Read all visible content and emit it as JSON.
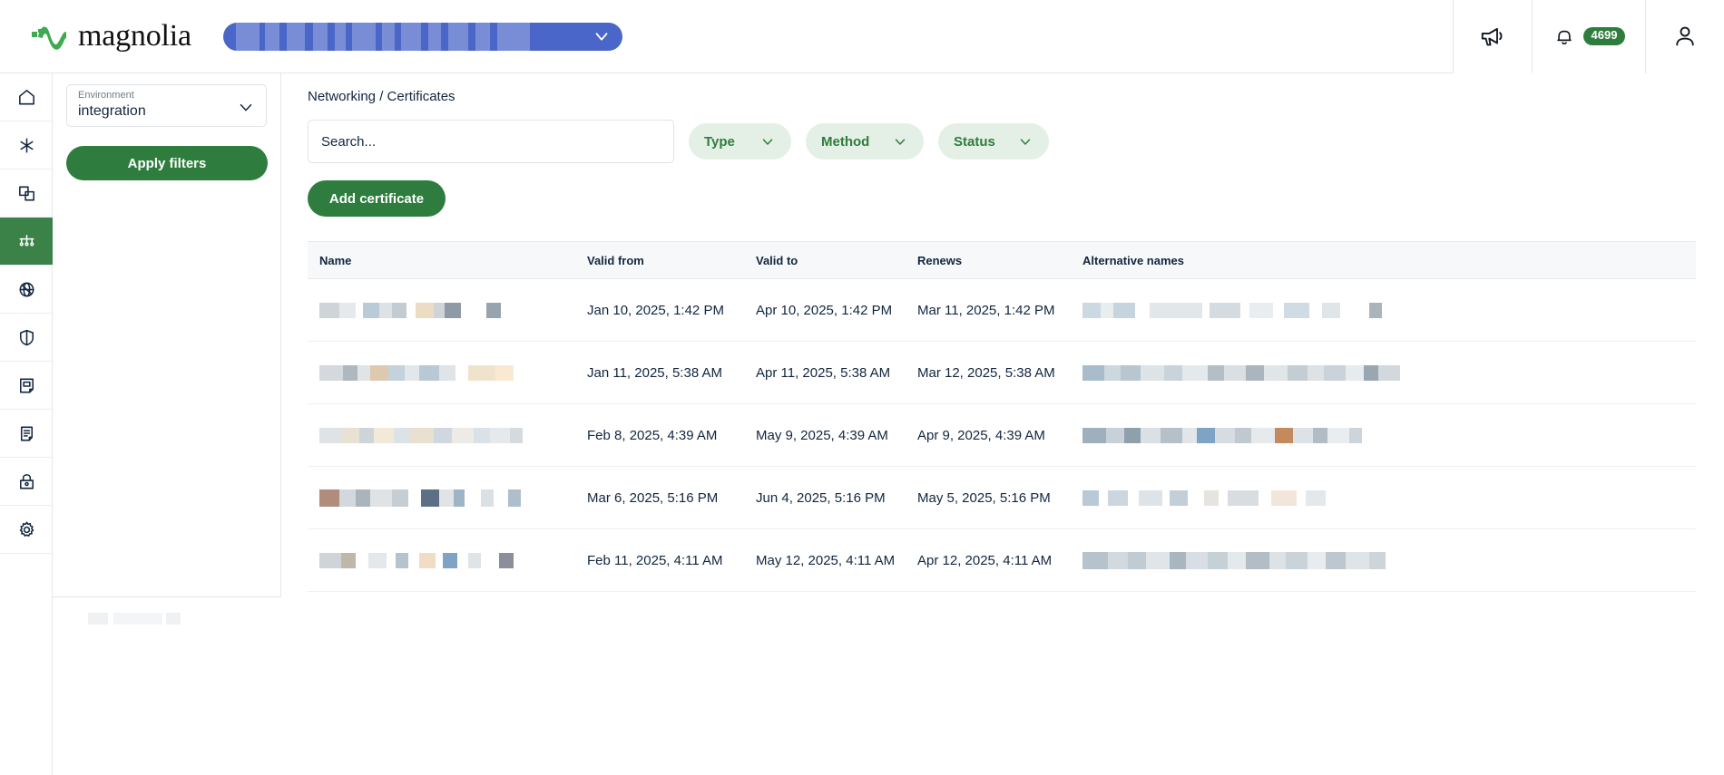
{
  "brand": {
    "name": "magnolia",
    "logo_icon": "magnolia-wave-logo",
    "accent_green": "#2e7d3e",
    "active_green": "#3b8249"
  },
  "topbar": {
    "env_selector": {
      "icon": "chevron-down-icon",
      "redacted": true
    },
    "announcements_icon": "megaphone-icon",
    "notifications_icon": "bell-icon",
    "notifications_count": "4699",
    "account_icon": "user-avatar-icon"
  },
  "rail": {
    "items": [
      {
        "name": "home",
        "icon": "home-icon",
        "active": false
      },
      {
        "name": "apps",
        "icon": "asterisk-icon",
        "active": false
      },
      {
        "name": "stacks",
        "icon": "layers-icon",
        "active": false
      },
      {
        "name": "networking",
        "icon": "network-icon",
        "active": true
      },
      {
        "name": "dns",
        "icon": "globe-slash-icon",
        "active": false
      },
      {
        "name": "security",
        "icon": "shield-icon",
        "active": false
      },
      {
        "name": "logs",
        "icon": "document-fold-icon",
        "active": false
      },
      {
        "name": "notes",
        "icon": "note-icon",
        "active": false
      },
      {
        "name": "secrets",
        "icon": "lock-icon",
        "active": false
      },
      {
        "name": "settings",
        "icon": "gear-icon",
        "active": false
      }
    ]
  },
  "filters": {
    "environment": {
      "label": "Environment",
      "value": "integration",
      "chevron_icon": "chevron-down-icon"
    },
    "apply_label": "Apply filters"
  },
  "main": {
    "breadcrumb": "Networking / Certificates",
    "search": {
      "placeholder": "Search...",
      "value": ""
    },
    "chips": [
      {
        "label": "Type",
        "icon": "chevron-down-icon"
      },
      {
        "label": "Method",
        "icon": "chevron-down-icon"
      },
      {
        "label": "Status",
        "icon": "chevron-down-icon"
      }
    ],
    "add_certificate_label": "Add certificate"
  },
  "table": {
    "columns": [
      "Name",
      "Valid from",
      "Valid to",
      "Renews",
      "Alternative names"
    ],
    "rows": [
      {
        "name_redacted": true,
        "valid_from": "Jan 10, 2025, 1:42 PM",
        "valid_to": "Apr 10, 2025, 1:42 PM",
        "renews": "Mar 11, 2025, 1:42 PM",
        "alt_names_redacted": true
      },
      {
        "name_redacted": true,
        "valid_from": "Jan 11, 2025, 5:38 AM",
        "valid_to": "Apr 11, 2025, 5:38 AM",
        "renews": "Mar 12, 2025, 5:38 AM",
        "alt_names_redacted": true
      },
      {
        "name_redacted": true,
        "valid_from": "Feb 8, 2025, 4:39 AM",
        "valid_to": "May 9, 2025, 4:39 AM",
        "renews": "Apr 9, 2025, 4:39 AM",
        "alt_names_redacted": true
      },
      {
        "name_redacted": true,
        "valid_from": "Mar 6, 2025, 5:16 PM",
        "valid_to": "Jun 4, 2025, 5:16 PM",
        "renews": "May 5, 2025, 5:16 PM",
        "alt_names_redacted": true
      },
      {
        "name_redacted": true,
        "valid_from": "Feb 11, 2025, 4:11 AM",
        "valid_to": "May 12, 2025, 4:11 AM",
        "renews": "Apr 12, 2025, 4:11 AM",
        "alt_names_redacted": true
      }
    ]
  }
}
